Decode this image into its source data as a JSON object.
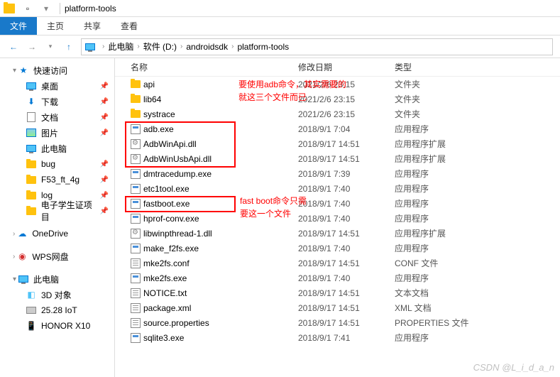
{
  "title": "platform-tools",
  "ribbon": {
    "file": "文件",
    "home": "主页",
    "share": "共享",
    "view": "查看"
  },
  "breadcrumbs": [
    "此电脑",
    "软件 (D:)",
    "androidsdk",
    "platform-tools"
  ],
  "sidebar": {
    "quick": {
      "label": "快速访问",
      "items": [
        {
          "label": "桌面",
          "icon": "monitor",
          "pin": true
        },
        {
          "label": "下载",
          "icon": "dl",
          "pin": true
        },
        {
          "label": "文档",
          "icon": "doc",
          "pin": true
        },
        {
          "label": "图片",
          "icon": "pic",
          "pin": true
        },
        {
          "label": "此电脑",
          "icon": "monitor",
          "pin": false
        },
        {
          "label": "bug",
          "icon": "folder",
          "pin": true
        },
        {
          "label": "F53_ft_4g",
          "icon": "folder",
          "pin": true
        },
        {
          "label": "log",
          "icon": "folder",
          "pin": true
        },
        {
          "label": "电子学生证项目",
          "icon": "folder",
          "pin": true
        }
      ]
    },
    "onedrive": "OneDrive",
    "wps": "WPS网盘",
    "thispc": {
      "label": "此电脑",
      "items": [
        {
          "label": "3D 对象",
          "icon": "cube"
        },
        {
          "label": "25.28 IoT",
          "icon": "drive"
        },
        {
          "label": "HONOR X10",
          "icon": "phone"
        }
      ]
    }
  },
  "columns": {
    "name": "名称",
    "date": "修改日期",
    "type": "类型"
  },
  "files": [
    {
      "name": "api",
      "date": "2021/2/6 23:15",
      "type": "文件夹",
      "icon": "folder"
    },
    {
      "name": "lib64",
      "date": "2021/2/6 23:15",
      "type": "文件夹",
      "icon": "folder"
    },
    {
      "name": "systrace",
      "date": "2021/2/6 23:15",
      "type": "文件夹",
      "icon": "folder"
    },
    {
      "name": "adb.exe",
      "date": "2018/9/1 7:04",
      "type": "应用程序",
      "icon": "exe"
    },
    {
      "name": "AdbWinApi.dll",
      "date": "2018/9/17 14:51",
      "type": "应用程序扩展",
      "icon": "dll"
    },
    {
      "name": "AdbWinUsbApi.dll",
      "date": "2018/9/17 14:51",
      "type": "应用程序扩展",
      "icon": "dll"
    },
    {
      "name": "dmtracedump.exe",
      "date": "2018/9/1 7:39",
      "type": "应用程序",
      "icon": "exe"
    },
    {
      "name": "etc1tool.exe",
      "date": "2018/9/1 7:40",
      "type": "应用程序",
      "icon": "exe"
    },
    {
      "name": "fastboot.exe",
      "date": "2018/9/1 7:40",
      "type": "应用程序",
      "icon": "exe"
    },
    {
      "name": "hprof-conv.exe",
      "date": "2018/9/1 7:40",
      "type": "应用程序",
      "icon": "exe"
    },
    {
      "name": "libwinpthread-1.dll",
      "date": "2018/9/17 14:51",
      "type": "应用程序扩展",
      "icon": "dll"
    },
    {
      "name": "make_f2fs.exe",
      "date": "2018/9/1 7:40",
      "type": "应用程序",
      "icon": "exe"
    },
    {
      "name": "mke2fs.conf",
      "date": "2018/9/17 14:51",
      "type": "CONF 文件",
      "icon": "txt"
    },
    {
      "name": "mke2fs.exe",
      "date": "2018/9/1 7:40",
      "type": "应用程序",
      "icon": "exe"
    },
    {
      "name": "NOTICE.txt",
      "date": "2018/9/17 14:51",
      "type": "文本文档",
      "icon": "txt"
    },
    {
      "name": "package.xml",
      "date": "2018/9/17 14:51",
      "type": "XML 文档",
      "icon": "txt"
    },
    {
      "name": "source.properties",
      "date": "2018/9/17 14:51",
      "type": "PROPERTIES 文件",
      "icon": "txt"
    },
    {
      "name": "sqlite3.exe",
      "date": "2018/9/1 7:41",
      "type": "应用程序",
      "icon": "exe"
    }
  ],
  "annotations": {
    "a1_line1": "要使用adb命令，其实需要的",
    "a1_line2": "就这三个文件而已",
    "a2_line1": "fast boot命令只需",
    "a2_line2": "要这一个文件"
  },
  "watermark": "CSDN @L_i_d_a_n"
}
